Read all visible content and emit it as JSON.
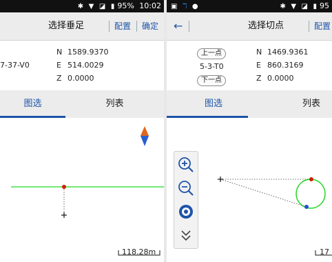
{
  "left": {
    "status": {
      "battery": "95%",
      "time": "10:02"
    },
    "title": "选择垂足",
    "config_label": "配置",
    "confirm_label": "确定",
    "point_name": "7-37-V0",
    "coords": [
      {
        "label": "N",
        "value": "1589.9370"
      },
      {
        "label": "E",
        "value": "514.0029"
      },
      {
        "label": "Z",
        "value": "0.0000"
      }
    ],
    "tabs": [
      {
        "label": "图选",
        "active": true
      },
      {
        "label": "列表",
        "active": false
      }
    ],
    "scale": "118.28m"
  },
  "right": {
    "status": {
      "battery": "95"
    },
    "title": "选择切点",
    "config_label": "配置",
    "prev_label": "上一点",
    "next_label": "下一点",
    "point_name": "5-3-T0",
    "coords": [
      {
        "label": "N",
        "value": "1469.9361"
      },
      {
        "label": "E",
        "value": "860.3169"
      },
      {
        "label": "Z",
        "value": "0.0000"
      }
    ],
    "tabs": [
      {
        "label": "图选",
        "active": true
      },
      {
        "label": "列表",
        "active": false
      }
    ],
    "scale": "17"
  },
  "tools": [
    "zoom-in-icon",
    "zoom-out-icon",
    "globe-icon",
    "chevron-double-down-icon"
  ],
  "colors": {
    "accent": "#1d54a8",
    "line_green": "#22d622",
    "point_red": "#cc2200",
    "point_blue": "#1f4ed8"
  }
}
